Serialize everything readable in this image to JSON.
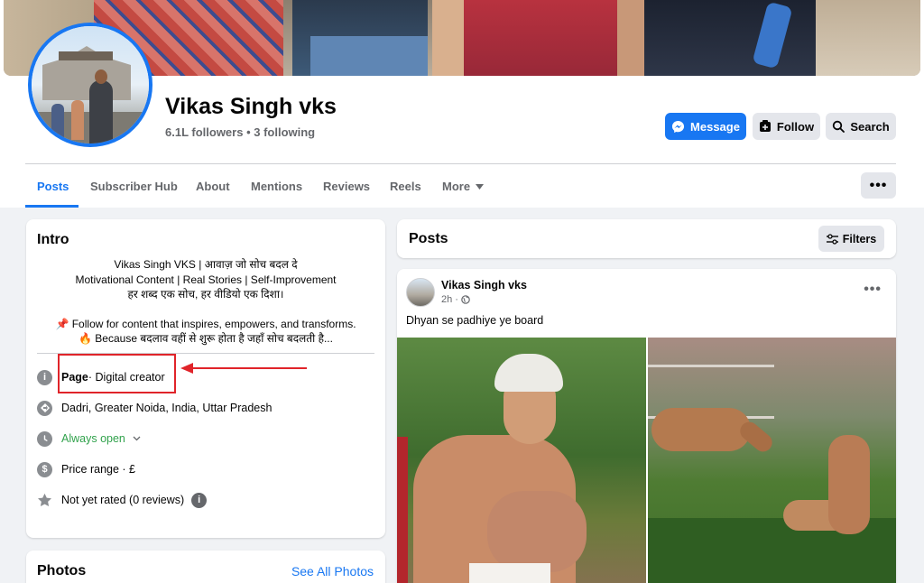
{
  "profile": {
    "name": "Vikas Singh vks",
    "stats": "6.1L followers • 3 following"
  },
  "actions": {
    "message": "Message",
    "follow": "Follow",
    "search": "Search",
    "more": "•••"
  },
  "tabs": [
    {
      "label": "Posts",
      "active": true
    },
    {
      "label": "Subscriber Hub"
    },
    {
      "label": "About"
    },
    {
      "label": "Mentions"
    },
    {
      "label": "Reviews"
    },
    {
      "label": "Reels"
    },
    {
      "label": "More"
    }
  ],
  "intro": {
    "title": "Intro",
    "bio": [
      "Vikas Singh VKS | आवाज़ जो सोच बदल दे",
      "Motivational Content | Real Stories | Self-Improvement",
      "हर शब्द एक सोच, हर वीडियो एक दिशा।",
      "📌 Follow for content that inspires, empowers, and transforms.",
      "🔥 Because बदलाव वहीं से शुरू होता है जहाँ सोच बदलती है..."
    ],
    "page_label": "Page",
    "page_category": " · Digital creator",
    "location": "Dadri, Greater Noida, India, Uttar Pradesh",
    "hours": "Always open",
    "price": "Price range · £",
    "rating": "Not yet rated (0 reviews)"
  },
  "photos": {
    "title": "Photos",
    "see_all": "See All Photos"
  },
  "posts_section": {
    "title": "Posts",
    "filters": "Filters"
  },
  "post": {
    "author": "Vikas Singh vks",
    "time": "2h ·",
    "text": "Dhyan se padhiye ye board",
    "menu": "•••"
  },
  "colors": {
    "accent": "#1877f2",
    "annotation_red": "#e0242a",
    "open_green": "#31a24c"
  }
}
